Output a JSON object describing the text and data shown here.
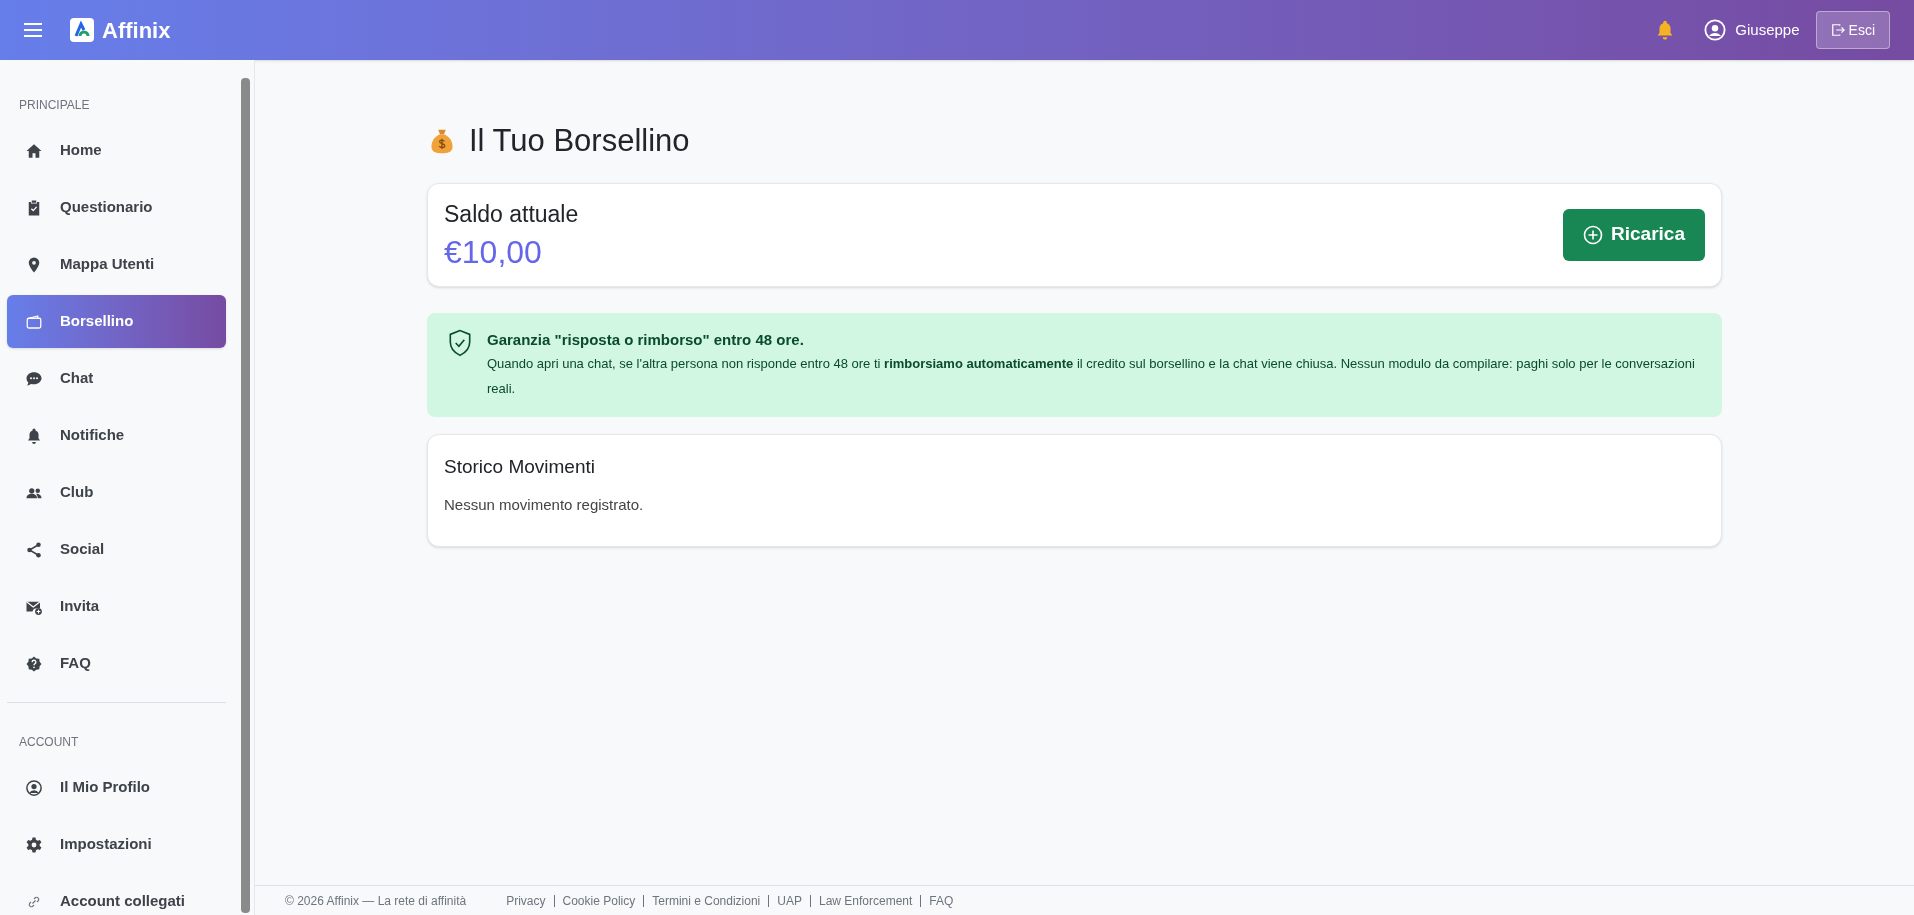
{
  "header": {
    "brand": "Affinix",
    "user": "Giuseppe",
    "logout": "Esci"
  },
  "sidebar": {
    "sections": [
      {
        "title": "PRINCIPALE",
        "items": [
          {
            "label": "Home",
            "kind": "home",
            "selected": false
          },
          {
            "label": "Questionario",
            "kind": "clipboard",
            "selected": false
          },
          {
            "label": "Mappa Utenti",
            "kind": "pin",
            "selected": false
          },
          {
            "label": "Borsellino",
            "kind": "wallet",
            "selected": true
          },
          {
            "label": "Chat",
            "kind": "chat",
            "selected": false
          },
          {
            "label": "Notifiche",
            "kind": "bell",
            "selected": false
          },
          {
            "label": "Club",
            "kind": "people",
            "selected": false
          },
          {
            "label": "Social",
            "kind": "share",
            "selected": false
          },
          {
            "label": "Invita",
            "kind": "invite",
            "selected": false
          },
          {
            "label": "FAQ",
            "kind": "question",
            "selected": false
          }
        ]
      },
      {
        "title": "ACCOUNT",
        "items": [
          {
            "label": "Il Mio Profilo",
            "kind": "profile",
            "selected": false
          },
          {
            "label": "Impostazioni",
            "kind": "gear",
            "selected": false
          },
          {
            "label": "Account collegati",
            "kind": "link",
            "selected": false
          }
        ]
      }
    ]
  },
  "page": {
    "title": "Il Tuo Borsellino",
    "balance": {
      "label": "Saldo attuale",
      "amount": "€10,00",
      "button": "Ricarica"
    },
    "guarantee": {
      "title": "Garanzia \"risposta o rimborso\" entro 48 ore.",
      "text": "Quando apri una chat, se l'altra persona non risponde entro 48 ore ti **rimborsiamo automaticamente** il credito sul borsellino e la chat viene chiusa. Nessun modulo da compilare: paghi solo per le conversazioni reali."
    },
    "history": {
      "title": "Storico Movimenti",
      "empty": "Nessun movimento registrato."
    }
  },
  "footer": {
    "copyright": "© 2026 Affinix — La rete di affinità",
    "links": [
      "Privacy",
      "Cookie Policy",
      "Termini e Condizioni",
      "UAP",
      "Law Enforcement",
      "FAQ"
    ]
  }
}
